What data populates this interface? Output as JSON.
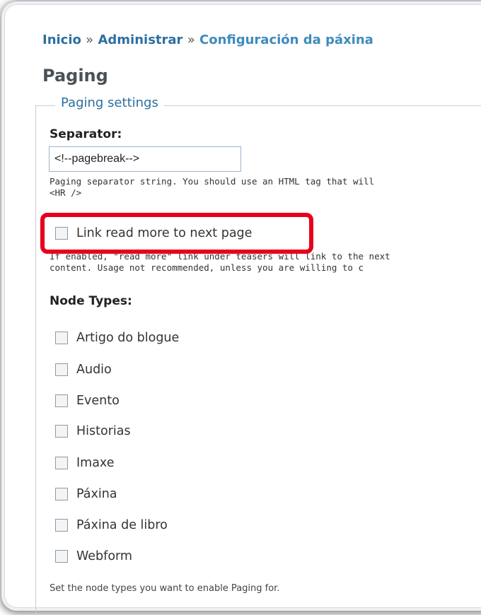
{
  "breadcrumb": {
    "home": "Inicio",
    "separator": "»",
    "admin": "Administrar",
    "current": "Configuración da páxina"
  },
  "page_title": "Paging",
  "fieldset": {
    "legend": "Paging settings",
    "separator": {
      "label": "Separator:",
      "value": "<!--pagebreak-->",
      "description_line1": "Paging separator string. You should use an HTML tag that will",
      "description_line2": "<HR />"
    },
    "read_more": {
      "label": "Link read more to next page",
      "checked": false,
      "description_line1": "If enabled, \"read more\" link under teasers will link to the next",
      "description_line2": "content. Usage not recommended, unless you are willing to c"
    },
    "node_types": {
      "label": "Node Types:",
      "items": [
        {
          "label": "Artigo do blogue",
          "checked": false
        },
        {
          "label": "Audio",
          "checked": false
        },
        {
          "label": "Evento",
          "checked": false
        },
        {
          "label": "Historias",
          "checked": false
        },
        {
          "label": "Imaxe",
          "checked": false
        },
        {
          "label": "Páxina",
          "checked": false
        },
        {
          "label": "Páxina de libro",
          "checked": false
        },
        {
          "label": "Webform",
          "checked": false
        }
      ],
      "help": "Set the node types you want to enable Paging for."
    }
  },
  "colors": {
    "link": "#2d6fa2",
    "highlight": "#e8001c",
    "title": "#4a5156"
  }
}
